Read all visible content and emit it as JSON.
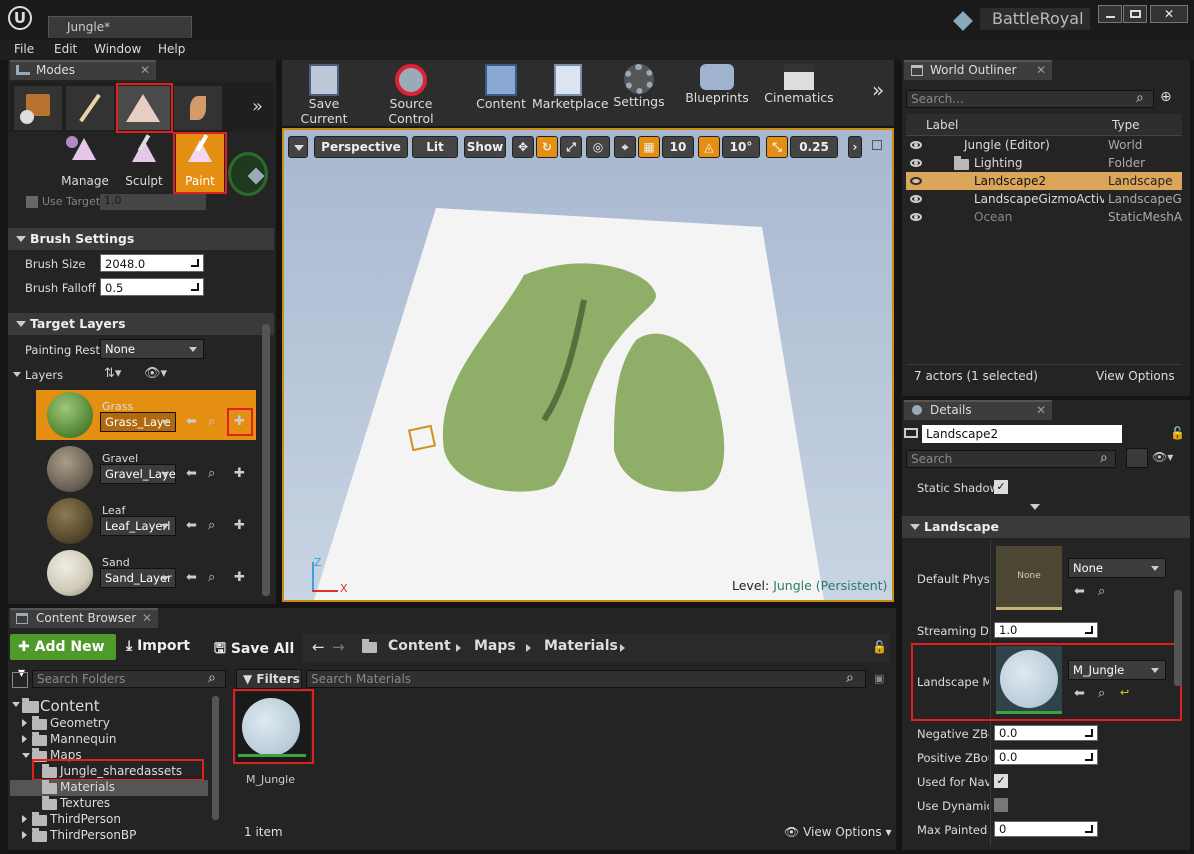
{
  "window": {
    "tab_title": "Jungle*",
    "project": "BattleRoyal"
  },
  "menu": [
    "File",
    "Edit",
    "Window",
    "Help"
  ],
  "modes": {
    "tab": "Modes",
    "tools": [
      "Manage",
      "Sculpt",
      "Paint"
    ],
    "use_target": "Use Target",
    "use_target_val": "1.0",
    "brush_settings": {
      "title": "Brush Settings",
      "size_label": "Brush Size",
      "size_value": "2048.0",
      "falloff_label": "Brush Falloff",
      "falloff_value": "0.5"
    },
    "target_layers": {
      "title": "Target Layers",
      "painting_label": "Painting Restr",
      "painting_value": "None",
      "layers_label": "Layers",
      "items": [
        {
          "name": "Grass",
          "layer": "Grass_Laye"
        },
        {
          "name": "Gravel",
          "layer": "Gravel_Laye"
        },
        {
          "name": "Leaf",
          "layer": "Leaf_Layerl"
        },
        {
          "name": "Sand",
          "layer": "Sand_Layer"
        }
      ]
    }
  },
  "toolbar": [
    "Save Current",
    "Source Control",
    "Content",
    "Marketplace",
    "Settings",
    "Blueprints",
    "Cinematics"
  ],
  "viewport": {
    "perspective": "Perspective",
    "lit": "Lit",
    "show": "Show",
    "grid": "10",
    "angle": "10°",
    "scale": "0.25",
    "level_label": "Level:",
    "level_value": "Jungle (Persistent)"
  },
  "outliner": {
    "tab": "World Outliner",
    "search": "Search...",
    "col_label": "Label",
    "col_type": "Type",
    "rows": [
      {
        "label": "Jungle (Editor)",
        "type": "World"
      },
      {
        "label": "Lighting",
        "type": "Folder"
      },
      {
        "label": "Landscape2",
        "type": "Landscape"
      },
      {
        "label": "LandscapeGizmoActiveA",
        "type": "LandscapeGiz"
      },
      {
        "label": "Ocean",
        "type": "StaticMeshAc"
      }
    ],
    "status": "7 actors (1 selected)",
    "view_options": "View Options"
  },
  "details": {
    "tab": "Details",
    "name": "Landscape2",
    "search": "Search",
    "static_shadow": "Static Shadow",
    "section": "Landscape",
    "phys_label": "Default Phys M",
    "phys_thumb": "None",
    "phys_value": "None",
    "stream_label": "Streaming Dist",
    "stream_value": "1.0",
    "mat_label": "Landscape Ma",
    "mat_value": "M_Jungle",
    "neg_label": "Negative ZBou",
    "neg_value": "0.0",
    "pos_label": "Positive ZBou",
    "pos_value": "0.0",
    "nav_label": "Used for Navig",
    "dyn_label": "Use Dynamic N",
    "max_label": "Max Painted L",
    "max_value": "0"
  },
  "content_browser": {
    "tab": "Content Browser",
    "add_new": "Add New",
    "import": "Import",
    "save_all": "Save All",
    "path": [
      "Content",
      "Maps",
      "Materials"
    ],
    "search_folders": "Search Folders",
    "filters": "Filters",
    "search_materials": "Search Materials",
    "tree": [
      "Content",
      "Geometry",
      "Mannequin",
      "Maps",
      "Jungle_sharedassets",
      "Materials",
      "Textures",
      "ThirdPerson",
      "ThirdPersonBP"
    ],
    "asset": "M_Jungle",
    "count": "1 item",
    "view_options": "View Options"
  }
}
